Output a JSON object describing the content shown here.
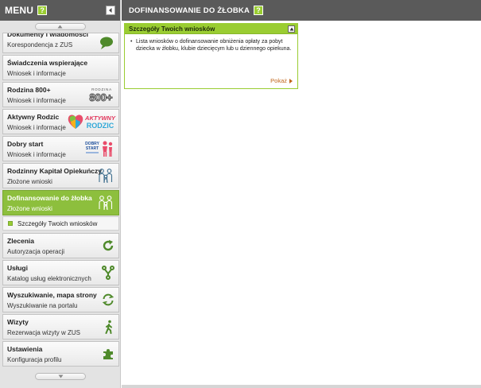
{
  "sidebar": {
    "title": "MENU",
    "help": "?",
    "items": [
      {
        "title": "Dokumenty i wiadomości",
        "subtitle": "Korespondencja z ZUS",
        "icon": "speech-bubble-icon"
      },
      {
        "title": "Świadczenia wspierające",
        "subtitle": "Wniosek i informacje",
        "icon": ""
      },
      {
        "title": "Rodzina 800+",
        "subtitle": "Wniosek i informacje",
        "icon": "rodzina-800-plus-logo",
        "logo_small": "RODZINA",
        "logo_big": "800+"
      },
      {
        "title": "Aktywny Rodzic",
        "subtitle": "Wniosek i informacje",
        "icon": "aktywny-rodzic-logo",
        "logo_line1": "AKTYWNY",
        "logo_line2": "RODZIC"
      },
      {
        "title": "Dobry start",
        "subtitle": "Wniosek i informacje",
        "icon": "dobry-start-logo",
        "logo_line1": "DOBRY",
        "logo_line2": "START"
      },
      {
        "title": "Rodzinny Kapitał Opiekuńczy",
        "subtitle": "Złożone wnioski",
        "icon": "family-icon"
      },
      {
        "title": "Dofinansowanie do żłobka",
        "subtitle": "Złożone wnioski",
        "icon": "family-icon",
        "active": true
      },
      {
        "title": "Zlecenia",
        "subtitle": "Autoryzacja operacji",
        "icon": "refresh-icon"
      },
      {
        "title": "Usługi",
        "subtitle": "Katalog usług elektronicznych",
        "icon": "network-icon"
      },
      {
        "title": "Wyszukiwanie, mapa strony",
        "subtitle": "Wyszukiwanie na portalu",
        "icon": "sync-icon"
      },
      {
        "title": "Wizyty",
        "subtitle": "Rezerwacja wizyty w ZUS",
        "icon": "walking-person-icon"
      },
      {
        "title": "Ustawienia",
        "subtitle": "Konfiguracja profilu",
        "icon": "puzzle-icon"
      }
    ],
    "subitem": "Szczegóły Twoich wniosków"
  },
  "main": {
    "title": "DOFINANSOWANIE DO ŻŁOBKA",
    "help": "?",
    "card": {
      "title": "Szczegóły Twoich wniosków",
      "text": "Lista wniosków o dofinansowanie obniżenia opłaty za pobyt dziecka w żłobku, klubie dziecięcym lub u dziennego opiekuna.",
      "more": "Pokaż"
    }
  },
  "colors": {
    "header_bg": "#5a5a5a",
    "accent_green": "#9acd32",
    "active_item": "#8dbf3d",
    "link_orange": "#c0651b"
  }
}
